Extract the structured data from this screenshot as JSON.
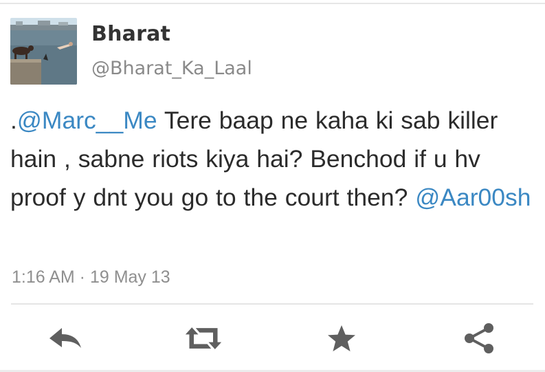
{
  "tweet": {
    "author_name": "Bharat",
    "author_handle": "@Bharat_Ka_Laal",
    "text_prefix": ".",
    "mention_1": "@Marc__Me",
    "text_body": "  Tere baap ne kaha ki sab killer hain , sabne riots kiya hai? Benchod if u hv proof y dnt you go to the court then? ",
    "mention_2": "@Aar00sh",
    "timestamp": "1:16 AM · 19 May 13"
  },
  "actions": [
    {
      "icon": "reply-icon"
    },
    {
      "icon": "retweet-icon"
    },
    {
      "icon": "star-icon"
    },
    {
      "icon": "share-icon"
    }
  ],
  "colors": {
    "mention": "#3b88c3",
    "icon": "#5f5f5f",
    "secondary_text": "#8a8a8a"
  }
}
